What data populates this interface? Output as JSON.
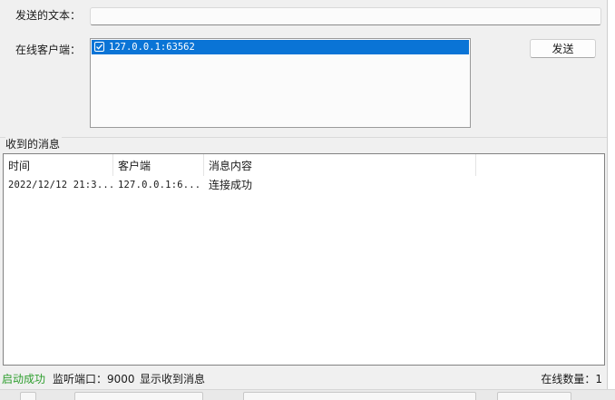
{
  "form": {
    "send_text_label": "发送的文本：",
    "send_text_value": "",
    "online_clients_label": "在线客户端：",
    "clients": [
      {
        "address": "127.0.0.1:63562",
        "checked": true,
        "selected": true
      }
    ],
    "send_button_label": "发送"
  },
  "messages": {
    "group_title": "收到的消息",
    "columns": [
      "时间",
      "客户端",
      "消息内容"
    ],
    "rows": [
      {
        "time": "2022/12/12 21:3...",
        "client": "127.0.0.1:6...",
        "content": "连接成功"
      }
    ]
  },
  "status": {
    "started": "启动成功",
    "listen_port": "监听端口：9000",
    "show_received": "显示收到消息",
    "online_count": "在线数量：1"
  },
  "colors": {
    "selection": "#0a74d6",
    "success_text": "#2e9e2e",
    "window_bg": "#f0f0f0"
  }
}
